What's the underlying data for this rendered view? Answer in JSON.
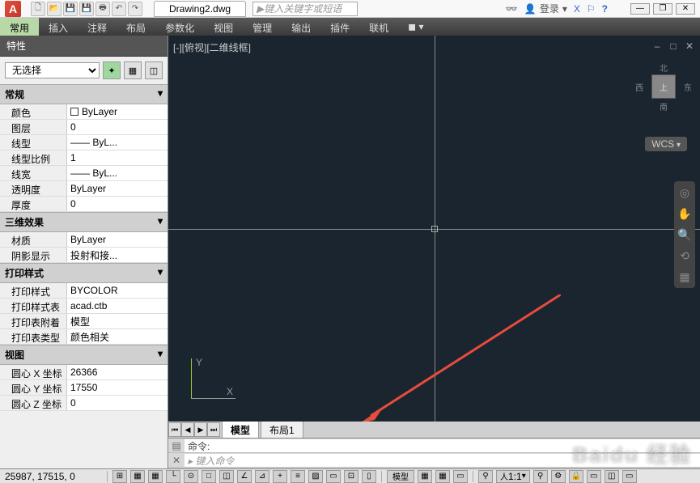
{
  "app": {
    "logo_letter": "A"
  },
  "titlebar": {
    "doc_name": "Drawing2.dwg",
    "search_placeholder": "键入关键字或短语",
    "login_label": "登录",
    "binoculars": "🔍",
    "help": "?",
    "x_icon": "X",
    "exchange": "⇄",
    "min": "—",
    "max": "❐",
    "close": "✕"
  },
  "ribbon": {
    "tabs": [
      "常用",
      "插入",
      "注释",
      "布局",
      "参数化",
      "视图",
      "管理",
      "输出",
      "插件",
      "联机"
    ]
  },
  "properties": {
    "title": "特性",
    "selection": "无选择",
    "groups": [
      {
        "name": "常规",
        "rows": [
          {
            "k": "颜色",
            "v": "ByLayer",
            "swatch": true
          },
          {
            "k": "图层",
            "v": "0"
          },
          {
            "k": "线型",
            "v": "—— ByL..."
          },
          {
            "k": "线型比例",
            "v": "1"
          },
          {
            "k": "线宽",
            "v": "—— ByL..."
          },
          {
            "k": "透明度",
            "v": "ByLayer"
          },
          {
            "k": "厚度",
            "v": "0"
          }
        ]
      },
      {
        "name": "三维效果",
        "rows": [
          {
            "k": "材质",
            "v": "ByLayer"
          },
          {
            "k": "阴影显示",
            "v": "投射和接..."
          }
        ]
      },
      {
        "name": "打印样式",
        "rows": [
          {
            "k": "打印样式",
            "v": "BYCOLOR"
          },
          {
            "k": "打印样式表",
            "v": "acad.ctb"
          },
          {
            "k": "打印表附着到",
            "v": "模型"
          },
          {
            "k": "打印表类型",
            "v": "颜色相关"
          }
        ]
      },
      {
        "name": "视图",
        "rows": [
          {
            "k": "圆心 X 坐标",
            "v": "26366"
          },
          {
            "k": "圆心 Y 坐标",
            "v": "17550"
          },
          {
            "k": "圆心 Z 坐标",
            "v": "0"
          }
        ]
      }
    ]
  },
  "viewport": {
    "label": "[-][俯视][二维线框]",
    "viewcube": {
      "n": "北",
      "s": "南",
      "e": "东",
      "w": "西",
      "face": "上"
    },
    "wcs": "WCS",
    "ucs_x": "X",
    "ucs_y": "Y"
  },
  "layout_tabs": {
    "model": "模型",
    "layout1": "布局1"
  },
  "command": {
    "prompt": "命令:",
    "hint": "键入命令"
  },
  "statusbar": {
    "coords": "25987, 17515, 0",
    "model_btn": "模型",
    "scale": "1:1"
  },
  "watermark": "Baidu 经验"
}
